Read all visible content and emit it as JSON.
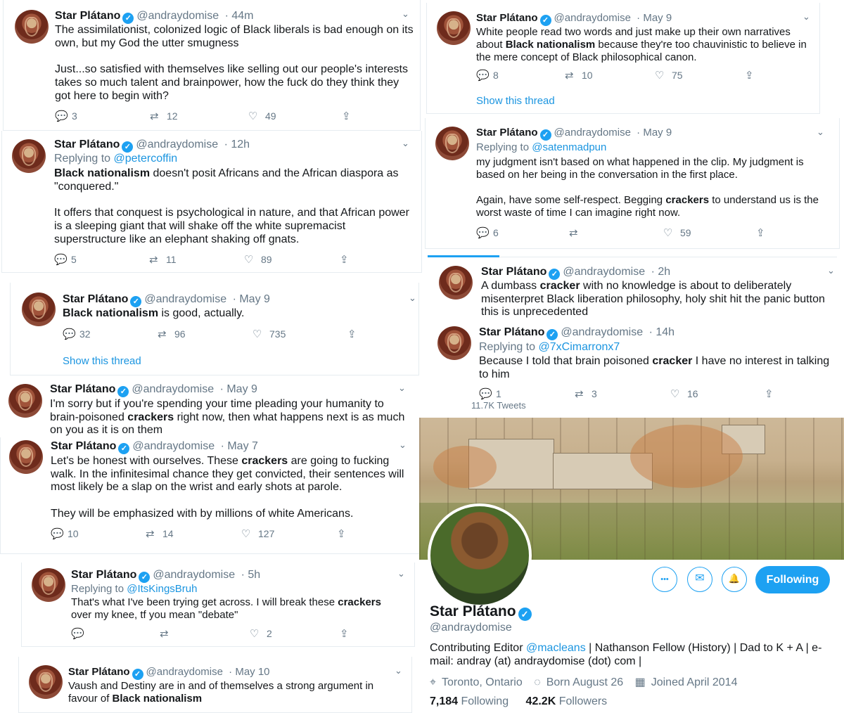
{
  "verified_mark": "✓",
  "icons": {
    "reply": "💬",
    "retweet": "⇄",
    "like": "♡",
    "share": "⇪",
    "chevron": "⌄"
  },
  "tweets": [
    {
      "name": "Star Plátano",
      "handle": "@andraydomise",
      "time": "· 44m",
      "text_parts": [
        "The assimilationist, colonized logic of Black liberals is bad enough on its own, but my God the utter smugness\n\nJust...so satisfied with themselves like selling out our people's interests takes so much talent and brainpower, how the fuck do they think they got here to begin with?"
      ],
      "replies": "3",
      "retweets": "12",
      "likes": "49"
    },
    {
      "name": "Star Plátano",
      "handle": "@andraydomise",
      "time": "· 12h",
      "replying_label": "Replying to",
      "replying_to": "@petercoffin",
      "bold1": "Black nationalism",
      "rest1": " doesn't posit Africans and the African diaspora as \"conquered.\"\n\nIt offers that conquest is psychological in nature, and that African power is a sleeping giant that will shake off the white supremacist superstructure like an elephant shaking off gnats.",
      "replies": "5",
      "retweets": "11",
      "likes": "89"
    },
    {
      "name": "Star Plátano",
      "handle": "@andraydomise",
      "time": "· May 9",
      "bold1": "Black nationalism",
      "rest1": " is good, actually.",
      "replies": "32",
      "retweets": "96",
      "likes": "735",
      "thread": "Show this thread"
    },
    {
      "name": "Star Plátano",
      "handle": "@andraydomise",
      "time": "· May 9",
      "pre": "I'm sorry but if you're spending your time pleading your humanity to brain-poisoned ",
      "bold1": "crackers",
      "rest1": " right now, then what happens next is as much on you as it is on them"
    },
    {
      "name": "Star Plátano",
      "handle": "@andraydomise",
      "time": "· May 7",
      "pre": "Let's be honest with ourselves. These ",
      "bold1": "crackers",
      "rest1": " are going to fucking walk. In the infinitesimal chance they get convicted, their sentences will most likely be a slap on the wrist and early shots at parole.\n\nThey will be emphasized with by millions of white Americans.",
      "replies": "10",
      "retweets": "14",
      "likes": "127"
    },
    {
      "name": "Star Plátano",
      "handle": "@andraydomise",
      "time": "· 5h",
      "replying_label": "Replying to",
      "replying_to": "@ItsKingsBruh",
      "pre": "That's what I've been trying get across. I will break these ",
      "bold1": "crackers",
      "rest1": " over my knee, tf you mean \"debate\"",
      "likes": "2"
    },
    {
      "name": "Star Plátano",
      "handle": "@andraydomise",
      "time": "· May 10",
      "pre": "Vaush and Destiny are in and of themselves a strong argument in favour of ",
      "bold1": "Black nationalism",
      "rest1": ""
    },
    {
      "name": "Star Plátano",
      "handle": "@andraydomise",
      "time": "· May 9",
      "pre": "White people read two words and just make up their own narratives about ",
      "bold1": "Black nationalism",
      "rest1": " because they're too chauvinistic to believe in the mere concept of Black philosophical canon.",
      "replies": "8",
      "retweets": "10",
      "likes": "75",
      "thread": "Show this thread"
    },
    {
      "name": "Star Plátano",
      "handle": "@andraydomise",
      "time": "· May 9",
      "replying_label": "Replying to",
      "replying_to": "@satenmadpun",
      "pre": "my judgment isn't based on what happened in the clip. My judgment is based on her being in the conversation in the first place.\n\nAgain, have some self-respect. Begging ",
      "bold1": "crackers",
      "rest1": " to understand us is the worst waste of time I can imagine right now.",
      "replies": "6",
      "likes": "59"
    },
    {
      "name": "Star Plátano",
      "handle": "@andraydomise",
      "time": "· 2h",
      "pre": "A dumbass ",
      "bold1": "cracker",
      "rest1": " with no knowledge is about to deliberately misenterpret Black liberation philosophy, holy shit hit the panic button this is unprecedented"
    },
    {
      "name": "Star Plátano",
      "handle": "@andraydomise",
      "time": "· 14h",
      "replying_label": "Replying to",
      "replying_to": "@7xCimarronx7",
      "pre": "Because I told that brain poisoned ",
      "bold1": "cracker",
      "rest1": " I have no interest in talking to him",
      "replies": "1",
      "retweets": "3",
      "likes": "16"
    }
  ],
  "profile": {
    "tweets_count_cut": "11.7K Tweets",
    "name": "Star Plátano",
    "handle": "@andraydomise",
    "bio_pre": "Contributing Editor ",
    "bio_link": "@macleans",
    "bio_post": " | Nathanson Fellow (History) | Dad to K + A | e-mail: andray (at) andraydomise (dot) com |",
    "location": "Toronto, Ontario",
    "born": "Born August 26",
    "joined": "Joined April 2014",
    "following_count": "7,184",
    "following_label": "Following",
    "followers_count": "42.2K",
    "followers_label": "Followers",
    "follow_button": "Following",
    "more_icon": "•••",
    "mail_icon": "✉",
    "bell_icon": "🔔",
    "location_icon": "⌖",
    "born_icon": "◌",
    "joined_icon": "▦"
  }
}
